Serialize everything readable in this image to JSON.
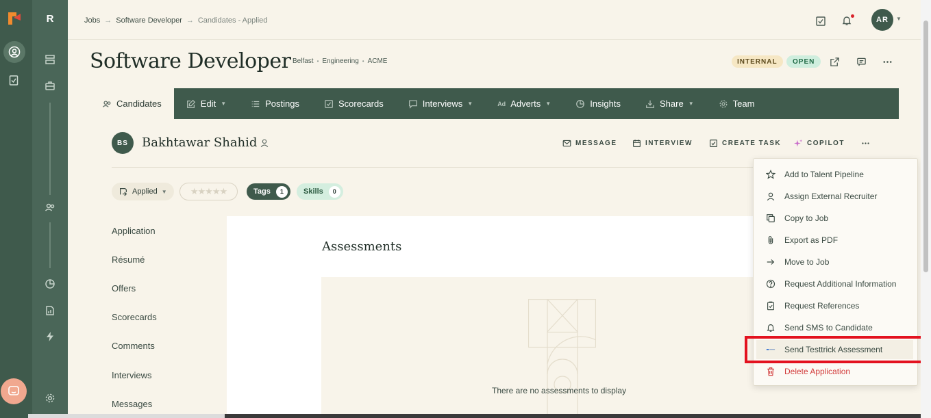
{
  "rail": {
    "workspace_letter": "R"
  },
  "breadcrumb": {
    "items": [
      "Jobs",
      "Software Developer",
      "Candidates - Applied"
    ],
    "separator": "→"
  },
  "user": {
    "initials": "AR"
  },
  "job": {
    "title": "Software Developer",
    "meta": [
      "Belfast",
      "Engineering",
      "ACME"
    ],
    "badge_internal": "INTERNAL",
    "badge_open": "OPEN"
  },
  "tabs": [
    {
      "label": "Candidates",
      "icon": "people-icon"
    },
    {
      "label": "Edit",
      "icon": "edit-icon"
    },
    {
      "label": "Postings",
      "icon": "list-icon"
    },
    {
      "label": "Scorecards",
      "icon": "checkbox-icon"
    },
    {
      "label": "Interviews",
      "icon": "chat-icon"
    },
    {
      "label": "Adverts",
      "icon": "ad-icon",
      "prefix": "Ad"
    },
    {
      "label": "Insights",
      "icon": "pie-icon"
    },
    {
      "label": "Share",
      "icon": "share-icon"
    },
    {
      "label": "Team",
      "icon": "gear-icon"
    }
  ],
  "candidate": {
    "initials": "BS",
    "name": "Bakhtawar Shahid",
    "actions": {
      "message": "MESSAGE",
      "interview": "INTERVIEW",
      "create_task": "CREATE TASK",
      "copilot": "COPILOT"
    },
    "stage": "Applied",
    "stars": "★★★★★",
    "tags_label": "Tags",
    "tags_count": "1",
    "skills_label": "Skills",
    "skills_count": "0"
  },
  "side_nav": [
    "Application",
    "Résumé",
    "Offers",
    "Scorecards",
    "Comments",
    "Interviews",
    "Messages"
  ],
  "main": {
    "title": "Assessments",
    "empty_text": "There are no assessments to display"
  },
  "menu": {
    "items": [
      {
        "label": "Add to Talent Pipeline",
        "icon": "star-icon"
      },
      {
        "label": "Assign External Recruiter",
        "icon": "person-icon"
      },
      {
        "label": "Copy to Job",
        "icon": "copy-icon"
      },
      {
        "label": "Export as PDF",
        "icon": "paperclip-icon"
      },
      {
        "label": "Move to Job",
        "icon": "arrow-right-icon"
      },
      {
        "label": "Request Additional Information",
        "icon": "question-icon"
      },
      {
        "label": "Request References",
        "icon": "clipboard-icon"
      },
      {
        "label": "Send SMS to Candidate",
        "icon": "bell-icon"
      },
      {
        "label": "Send Testtrick Assessment",
        "icon": "testtrick-icon"
      },
      {
        "label": "Delete Application",
        "icon": "trash-icon"
      }
    ]
  },
  "colors": {
    "brand_green": "#3f5a4c",
    "background": "#f8f4ea",
    "danger": "#d23c3c",
    "highlight_frame": "#e3121f"
  }
}
